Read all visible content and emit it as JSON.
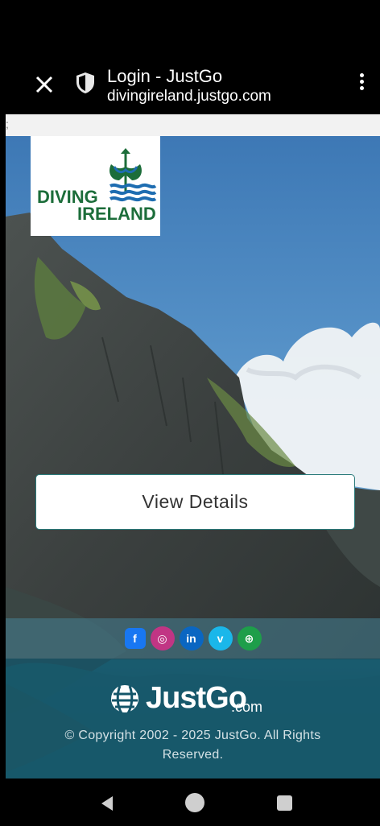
{
  "browser": {
    "title": "Login - JustGo",
    "url": "divingireland.justgo.com"
  },
  "logo": {
    "line1": "DIVING",
    "line2": "IRELAND"
  },
  "main": {
    "details_button": "View Details"
  },
  "social": {
    "links": [
      "f",
      "◎",
      "in",
      "v",
      "⊕"
    ],
    "icon_names": [
      "facebook-icon",
      "instagram-icon",
      "linkedin-icon",
      "vimeo-icon",
      "globe-icon"
    ],
    "colors": [
      "#1877f2",
      "#c13584",
      "#0a66c2",
      "#1ab7ea",
      "#1e9e4a"
    ]
  },
  "footer": {
    "brand": "JustGo",
    "brand_suffix": ".com",
    "copyright": "© Copyright 2002 - 2025 JustGo. All Rights Reserved."
  },
  "colors": {
    "logo_green": "#1c6d3a",
    "logo_blue": "#1e6db1",
    "footer_teal": "#145569"
  }
}
